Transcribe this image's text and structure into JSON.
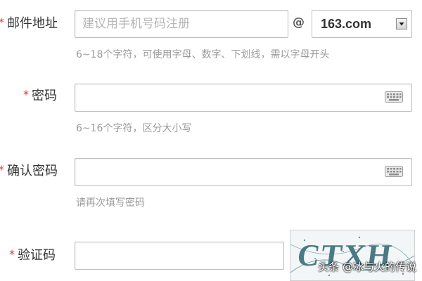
{
  "email": {
    "label": "邮件地址",
    "placeholder": "建议用手机号码注册",
    "at": "@",
    "domain": "163.com",
    "hint": "6~18个字符，可使用字母、数字、下划线，需以字母开头"
  },
  "password": {
    "label": "密码",
    "hint": "6~16个字符，区分大小写"
  },
  "confirm_password": {
    "label": "确认密码",
    "hint": "请再次填写密码"
  },
  "captcha": {
    "label": "验证码",
    "image_text": "CTXH"
  },
  "required_marker": "*",
  "watermark": "头条 @冰与火的传说",
  "colors": {
    "required": "#e4393c",
    "hint": "#9a9a9a",
    "border": "#bdbdbd"
  }
}
